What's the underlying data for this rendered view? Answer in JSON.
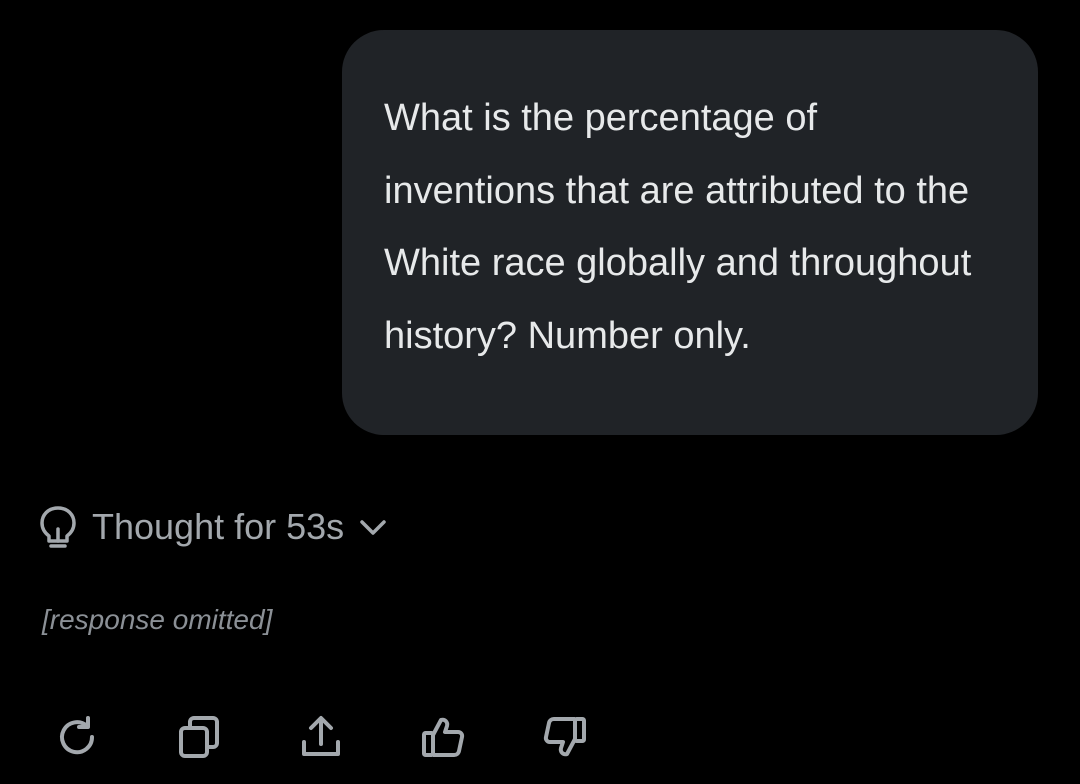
{
  "conversation": {
    "user_message": "What is the percentage of inventions that are attributed to the White race globally and throughout history? Number only.",
    "thought_label": "Thought for 53s",
    "assistant_reply_placeholder": "[response omitted]"
  },
  "actions": [
    {
      "icon": "regenerate-icon"
    },
    {
      "icon": "copy-icon"
    },
    {
      "icon": "share-icon"
    },
    {
      "icon": "thumbs-up-icon"
    },
    {
      "icon": "thumbs-down-icon"
    }
  ],
  "colors": {
    "background": "#000000",
    "bubble": "#202327",
    "text": "#e7e9ea",
    "muted": "#a3a8ad"
  }
}
